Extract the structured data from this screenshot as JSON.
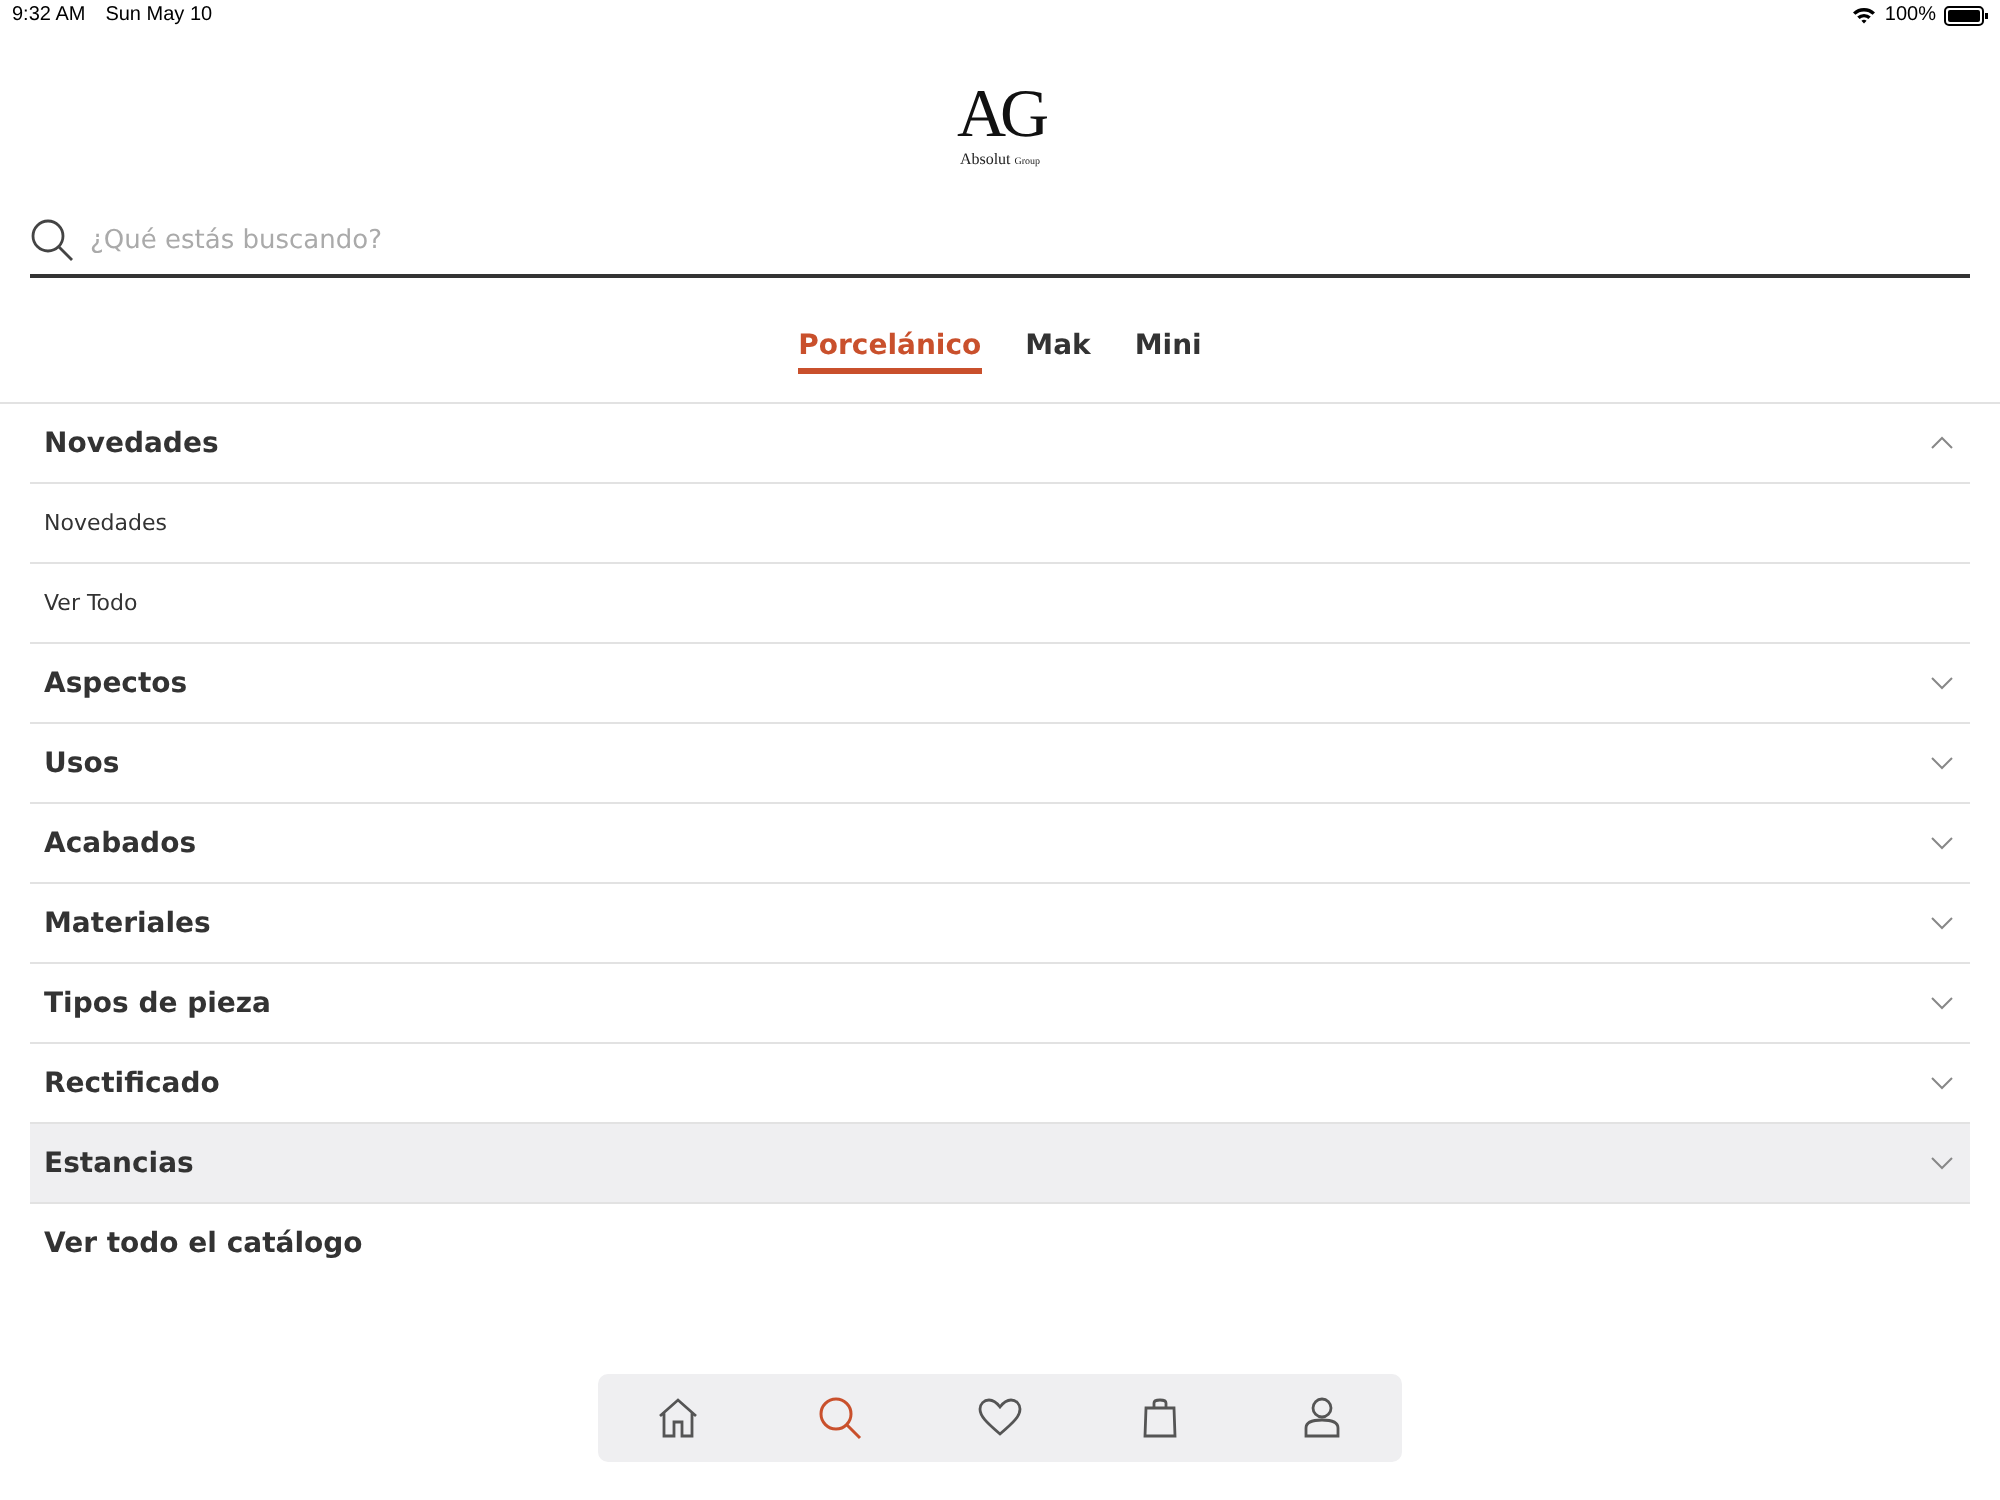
{
  "status_bar": {
    "time": "9:32 AM",
    "date": "Sun May 10",
    "battery": "100%"
  },
  "logo": {
    "mark": "AG",
    "name": "Absolut",
    "suffix": "Group"
  },
  "search": {
    "placeholder": "¿Qué estás buscando?"
  },
  "tabs": [
    {
      "label": "Porcelánico",
      "selected": true
    },
    {
      "label": "Mak",
      "selected": false
    },
    {
      "label": "Mini",
      "selected": false
    }
  ],
  "sections": [
    {
      "title": "Novedades",
      "expanded": true,
      "highlighted": false,
      "children": [
        {
          "label": "Novedades"
        },
        {
          "label": "Ver Todo"
        }
      ]
    },
    {
      "title": "Aspectos",
      "expanded": false,
      "highlighted": false
    },
    {
      "title": "Usos",
      "expanded": false,
      "highlighted": false
    },
    {
      "title": "Acabados",
      "expanded": false,
      "highlighted": false
    },
    {
      "title": "Materiales",
      "expanded": false,
      "highlighted": false
    },
    {
      "title": "Tipos de pieza",
      "expanded": false,
      "highlighted": false
    },
    {
      "title": "Rectificado",
      "expanded": false,
      "highlighted": false
    },
    {
      "title": "Estancias",
      "expanded": false,
      "highlighted": true
    }
  ],
  "catalog_link": "Ver todo el catálogo",
  "nav": [
    {
      "kind": "home",
      "selected": false
    },
    {
      "kind": "search",
      "selected": true
    },
    {
      "kind": "heart",
      "selected": false
    },
    {
      "kind": "bag",
      "selected": false
    },
    {
      "kind": "user",
      "selected": false
    }
  ]
}
